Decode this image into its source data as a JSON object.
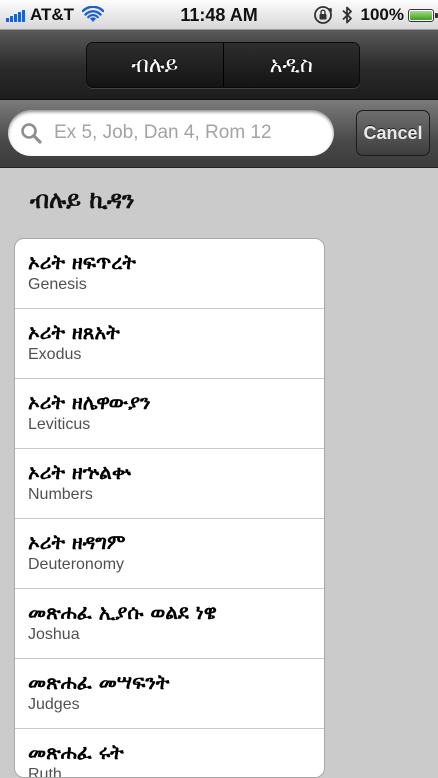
{
  "status_bar": {
    "carrier": "AT&T",
    "time": "11:48 AM",
    "battery": "100%"
  },
  "tabs": [
    {
      "label": "ብሉይ"
    },
    {
      "label": "አዲስ"
    }
  ],
  "search": {
    "placeholder": "Ex 5, Job, Dan 4, Rom 12",
    "value": "",
    "cancel_label": "Cancel"
  },
  "section_title": "ብሉይ ኪዳን",
  "books": [
    {
      "name": "ኦሪት ዘፍጥረት",
      "english": "Genesis"
    },
    {
      "name": "ኦሪት ዘጸአት",
      "english": "Exodus"
    },
    {
      "name": "ኦሪት ዘሌዋውያን",
      "english": "Leviticus"
    },
    {
      "name": "ኦሪት ዘኍልቍ",
      "english": "Numbers"
    },
    {
      "name": "ኦሪት ዘዳግም",
      "english": "Deuteronomy"
    },
    {
      "name": "መጽሐፈ ኢያሱ ወልደ ነዌ",
      "english": "Joshua"
    },
    {
      "name": "መጽሐፈ መሣፍንት",
      "english": "Judges"
    },
    {
      "name": "መጽሐፈ ሩት",
      "english": "Ruth"
    }
  ],
  "colors": {
    "accent_signal": "#1f5fc9",
    "battery_green": "#3f9f1e",
    "background": "#cbcbcb"
  },
  "icons": [
    "signal-bars-icon",
    "wifi-icon",
    "rotation-lock-icon",
    "bluetooth-icon",
    "battery-icon",
    "search-icon"
  ]
}
